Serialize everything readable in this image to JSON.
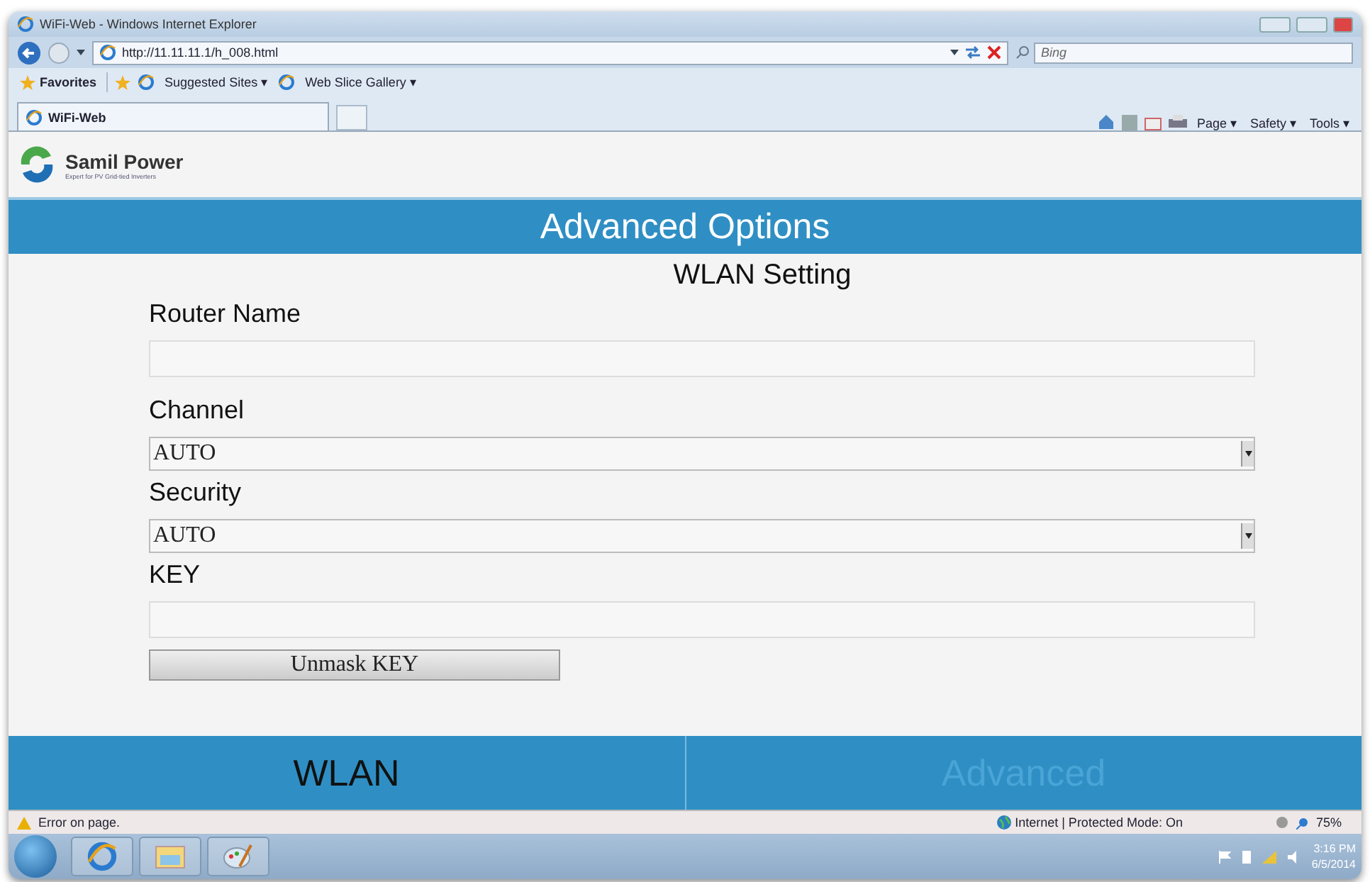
{
  "window": {
    "title": "WiFi-Web - Windows Internet Explorer"
  },
  "address_bar": {
    "url": "http://11.11.11.1/h_008.html"
  },
  "search": {
    "placeholder": "Bing"
  },
  "favorites_bar": {
    "label": "Favorites",
    "items": [
      "Suggested Sites ▾",
      "Web Slice Gallery ▾"
    ]
  },
  "tabs": [
    {
      "label": "WiFi-Web",
      "selected": true
    }
  ],
  "command_bar": [
    "Page ▾",
    "Safety ▾",
    "Tools ▾"
  ],
  "page": {
    "brand": "Samil Power",
    "tagline": "Expert for PV Grid-tied Inverters",
    "header": "Advanced Options",
    "section_title": "WLAN Setting",
    "fields": [
      {
        "kind": "text",
        "label": "Router Name"
      },
      {
        "kind": "select",
        "label": "Channel",
        "value": "AUTO"
      },
      {
        "kind": "select",
        "label": "Security",
        "value": "AUTO"
      },
      {
        "kind": "text",
        "label": "KEY"
      }
    ],
    "button": "Unmask KEY",
    "nav": [
      {
        "label": "WLAN",
        "selected": true
      },
      {
        "label": "Advanced",
        "selected": false
      }
    ]
  },
  "status_bar": {
    "message": "Error on page.",
    "zone": "Internet | Protected Mode: On",
    "zoom": "75%"
  },
  "taskbar": {
    "time": "3:16 PM",
    "date": "6/5/2014"
  }
}
